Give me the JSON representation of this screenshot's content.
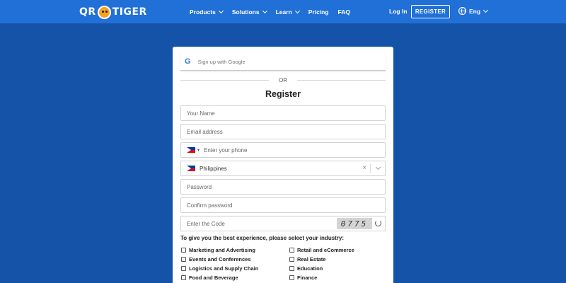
{
  "nav": {
    "logo_left": "QR",
    "logo_right": "TIGER",
    "links": [
      {
        "label": "Products",
        "has_dropdown": true
      },
      {
        "label": "Solutions",
        "has_dropdown": true
      },
      {
        "label": "Learn",
        "has_dropdown": true
      },
      {
        "label": "Pricing",
        "has_dropdown": false
      },
      {
        "label": "FAQ",
        "has_dropdown": false
      }
    ],
    "login_label": "Log In",
    "register_label": "REGISTER",
    "language_label": "Eng"
  },
  "form": {
    "google_label": "Sign up with Google",
    "or_label": "OR",
    "title": "Register",
    "name_placeholder": "Your Name",
    "email_placeholder": "Email address",
    "phone_placeholder": "Enter your phone",
    "country_value": "Philippines",
    "password_placeholder": "Password",
    "confirm_password_placeholder": "Confirm password",
    "code_placeholder": "Enter the Code",
    "captcha_value": "0775",
    "industry_prompt": "To give you the best experience, please select your industry:",
    "industries_left": [
      "Marketing and Advertising",
      "Events and Conferences",
      "Logistics and Supply Chain",
      "Food and Beverage"
    ],
    "industries_right": [
      "Retail and eCommerce",
      "Real Estate",
      "Education",
      "Finance"
    ]
  },
  "colors": {
    "navbar": "#2070d8",
    "background": "#1553a8",
    "card": "#ffffff"
  }
}
